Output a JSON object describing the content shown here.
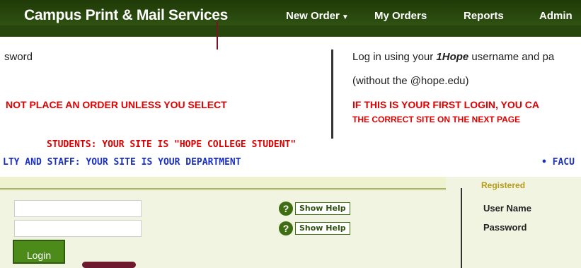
{
  "nav": {
    "brand": "Campus Print & Mail Services",
    "items": [
      {
        "label": "New Order",
        "has_dropdown": true
      },
      {
        "label": "My Orders"
      },
      {
        "label": "Reports"
      },
      {
        "label": "Admin"
      }
    ],
    "caret": "▼"
  },
  "instructions": {
    "left_password": "sword",
    "right_line1_pre": "Log in using your ",
    "right_line1_em": "1Hope",
    "right_line1_post": " username and pa",
    "right_line2": "(without the @hope.edu)",
    "warning_left": "NOT PLACE AN ORDER UNLESS YOU SELECT",
    "warning_right": "IF THIS IS YOUR FIRST LOGIN, YOU CA",
    "warning_right2": "THE CORRECT SITE ON THE NEXT PAGE",
    "students": "STUDENTS: YOUR SITE IS \"HOPE COLLEGE STUDENT\"",
    "faculty": "LTY AND STAFF: YOUR SITE IS YOUR DEPARTMENT",
    "faculty_right": "• FACU"
  },
  "login_panel": {
    "username_value": "",
    "password_value": "",
    "help_icon": "?",
    "help_label": "Show Help",
    "login_label": "Login"
  },
  "register_panel": {
    "heading": "Registered",
    "user_name_label": "User Name",
    "password_label": "Password"
  },
  "colors": {
    "nav_bg": "#2c4a0f",
    "warning": "#e00000",
    "info_blue": "#1a2fc4",
    "login_button": "#4c8a1a"
  }
}
